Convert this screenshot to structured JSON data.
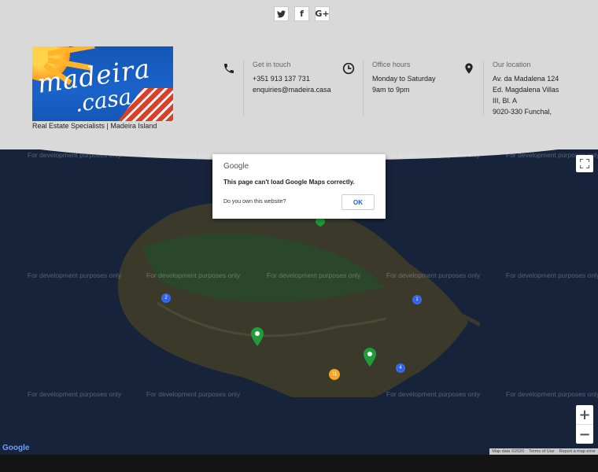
{
  "social": [
    {
      "name": "twitter-icon",
      "glyph": "🐦︎"
    },
    {
      "name": "facebook-icon",
      "glyph": "f"
    },
    {
      "name": "google-plus-icon",
      "glyph": "G+"
    }
  ],
  "logo": {
    "word1": "madeira",
    "word2": ".casa"
  },
  "tagline": "Real Estate Specialists | Madeira Island",
  "contact": {
    "title": "Get in touch",
    "phone": "+351 913 137 731",
    "email": "enquiries@madeira.casa"
  },
  "hours": {
    "title": "Office hours",
    "days": "Monday to Saturday",
    "time": "9am to 9pm"
  },
  "location": {
    "title": "Our location",
    "line1": "Av. da Madalena 124",
    "line2": "Ed. Magdalena Villas",
    "line3": "III, Bl. A",
    "line4": "9020-330 Funchal,"
  },
  "map": {
    "watermark": "For development purposes only",
    "clusters": [
      "2",
      "1",
      "4",
      "11"
    ],
    "google_logo": "Google",
    "attribution": [
      "Map data ©2020",
      "Terms of Use",
      "Report a map error"
    ],
    "zoom_in": "+",
    "zoom_out": "−"
  },
  "dialog": {
    "brand": "Google",
    "message": "This page can't load Google Maps correctly.",
    "question": "Do you own this website?",
    "ok": "OK"
  },
  "colors": {
    "header_bg": "#d9d9d9",
    "map_bg": "#16233a",
    "land": "#3a3a2a",
    "marker_green": "#1f9d3a",
    "cluster_blue": "#2f63e0",
    "cluster_orange": "#f5a623"
  }
}
